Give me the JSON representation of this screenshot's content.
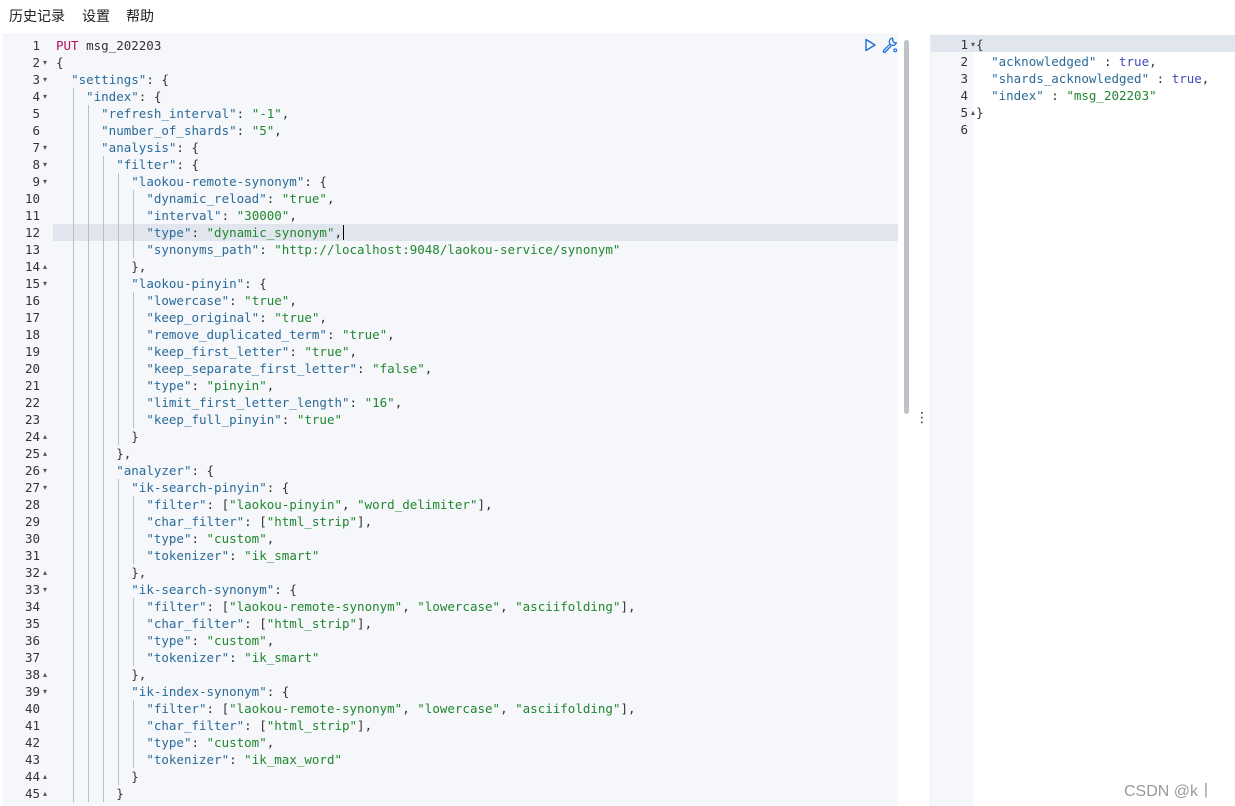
{
  "menu": [
    "历史记录",
    "设置",
    "帮助"
  ],
  "request": {
    "method": "PUT",
    "index": "msg_202203"
  },
  "editor_lines": [
    {
      "n": "1",
      "fold": "",
      "tokens": [
        [
          "m",
          "PUT"
        ],
        [
          "p",
          " msg_202203"
        ]
      ]
    },
    {
      "n": "2",
      "fold": "▾",
      "tokens": [
        [
          "p",
          "{"
        ]
      ]
    },
    {
      "n": "3",
      "fold": "▾",
      "tokens": [
        [
          "p",
          "  "
        ],
        [
          "k",
          "\"settings\""
        ],
        [
          "p",
          ": {"
        ]
      ]
    },
    {
      "n": "4",
      "fold": "▾",
      "tokens": [
        [
          "p",
          "    "
        ],
        [
          "k",
          "\"index\""
        ],
        [
          "p",
          ": {"
        ]
      ]
    },
    {
      "n": "5",
      "fold": "",
      "tokens": [
        [
          "p",
          "      "
        ],
        [
          "k",
          "\"refresh_interval\""
        ],
        [
          "p",
          ": "
        ],
        [
          "s",
          "\"-1\""
        ],
        [
          "p",
          ","
        ]
      ]
    },
    {
      "n": "6",
      "fold": "",
      "tokens": [
        [
          "p",
          "      "
        ],
        [
          "k",
          "\"number_of_shards\""
        ],
        [
          "p",
          ": "
        ],
        [
          "s",
          "\"5\""
        ],
        [
          "p",
          ","
        ]
      ]
    },
    {
      "n": "7",
      "fold": "▾",
      "tokens": [
        [
          "p",
          "      "
        ],
        [
          "k",
          "\"analysis\""
        ],
        [
          "p",
          ": {"
        ]
      ]
    },
    {
      "n": "8",
      "fold": "▾",
      "tokens": [
        [
          "p",
          "        "
        ],
        [
          "k",
          "\"filter\""
        ],
        [
          "p",
          ": {"
        ]
      ]
    },
    {
      "n": "9",
      "fold": "▾",
      "tokens": [
        [
          "p",
          "          "
        ],
        [
          "k",
          "\"laokou-remote-synonym\""
        ],
        [
          "p",
          ": {"
        ]
      ]
    },
    {
      "n": "10",
      "fold": "",
      "tokens": [
        [
          "p",
          "            "
        ],
        [
          "k",
          "\"dynamic_reload\""
        ],
        [
          "p",
          ": "
        ],
        [
          "s",
          "\"true\""
        ],
        [
          "p",
          ","
        ]
      ]
    },
    {
      "n": "11",
      "fold": "",
      "tokens": [
        [
          "p",
          "            "
        ],
        [
          "k",
          "\"interval\""
        ],
        [
          "p",
          ": "
        ],
        [
          "s",
          "\"30000\""
        ],
        [
          "p",
          ","
        ]
      ]
    },
    {
      "n": "12",
      "fold": "",
      "tokens": [
        [
          "p",
          "            "
        ],
        [
          "k",
          "\"type\""
        ],
        [
          "p",
          ": "
        ],
        [
          "s",
          "\"dynamic_synonym\""
        ],
        [
          "p",
          ","
        ]
      ]
    },
    {
      "n": "13",
      "fold": "",
      "tokens": [
        [
          "p",
          "            "
        ],
        [
          "k",
          "\"synonyms_path\""
        ],
        [
          "p",
          ": "
        ],
        [
          "s",
          "\"http://localhost:9048/laokou-service/synonym\""
        ]
      ]
    },
    {
      "n": "14",
      "fold": "▴",
      "tokens": [
        [
          "p",
          "          },"
        ]
      ]
    },
    {
      "n": "15",
      "fold": "▾",
      "tokens": [
        [
          "p",
          "          "
        ],
        [
          "k",
          "\"laokou-pinyin\""
        ],
        [
          "p",
          ": {"
        ]
      ]
    },
    {
      "n": "16",
      "fold": "",
      "tokens": [
        [
          "p",
          "            "
        ],
        [
          "k",
          "\"lowercase\""
        ],
        [
          "p",
          ": "
        ],
        [
          "s",
          "\"true\""
        ],
        [
          "p",
          ","
        ]
      ]
    },
    {
      "n": "17",
      "fold": "",
      "tokens": [
        [
          "p",
          "            "
        ],
        [
          "k",
          "\"keep_original\""
        ],
        [
          "p",
          ": "
        ],
        [
          "s",
          "\"true\""
        ],
        [
          "p",
          ","
        ]
      ]
    },
    {
      "n": "18",
      "fold": "",
      "tokens": [
        [
          "p",
          "            "
        ],
        [
          "k",
          "\"remove_duplicated_term\""
        ],
        [
          "p",
          ": "
        ],
        [
          "s",
          "\"true\""
        ],
        [
          "p",
          ","
        ]
      ]
    },
    {
      "n": "19",
      "fold": "",
      "tokens": [
        [
          "p",
          "            "
        ],
        [
          "k",
          "\"keep_first_letter\""
        ],
        [
          "p",
          ": "
        ],
        [
          "s",
          "\"true\""
        ],
        [
          "p",
          ","
        ]
      ]
    },
    {
      "n": "20",
      "fold": "",
      "tokens": [
        [
          "p",
          "            "
        ],
        [
          "k",
          "\"keep_separate_first_letter\""
        ],
        [
          "p",
          ": "
        ],
        [
          "s",
          "\"false\""
        ],
        [
          "p",
          ","
        ]
      ]
    },
    {
      "n": "21",
      "fold": "",
      "tokens": [
        [
          "p",
          "            "
        ],
        [
          "k",
          "\"type\""
        ],
        [
          "p",
          ": "
        ],
        [
          "s",
          "\"pinyin\""
        ],
        [
          "p",
          ","
        ]
      ]
    },
    {
      "n": "22",
      "fold": "",
      "tokens": [
        [
          "p",
          "            "
        ],
        [
          "k",
          "\"limit_first_letter_length\""
        ],
        [
          "p",
          ": "
        ],
        [
          "s",
          "\"16\""
        ],
        [
          "p",
          ","
        ]
      ]
    },
    {
      "n": "23",
      "fold": "",
      "tokens": [
        [
          "p",
          "            "
        ],
        [
          "k",
          "\"keep_full_pinyin\""
        ],
        [
          "p",
          ": "
        ],
        [
          "s",
          "\"true\""
        ]
      ]
    },
    {
      "n": "24",
      "fold": "▴",
      "tokens": [
        [
          "p",
          "          }"
        ]
      ]
    },
    {
      "n": "25",
      "fold": "▴",
      "tokens": [
        [
          "p",
          "        },"
        ]
      ]
    },
    {
      "n": "26",
      "fold": "▾",
      "tokens": [
        [
          "p",
          "        "
        ],
        [
          "k",
          "\"analyzer\""
        ],
        [
          "p",
          ": {"
        ]
      ]
    },
    {
      "n": "27",
      "fold": "▾",
      "tokens": [
        [
          "p",
          "          "
        ],
        [
          "k",
          "\"ik-search-pinyin\""
        ],
        [
          "p",
          ": {"
        ]
      ]
    },
    {
      "n": "28",
      "fold": "",
      "tokens": [
        [
          "p",
          "            "
        ],
        [
          "k",
          "\"filter\""
        ],
        [
          "p",
          ": ["
        ],
        [
          "s",
          "\"laokou-pinyin\""
        ],
        [
          "p",
          ", "
        ],
        [
          "s",
          "\"word_delimiter\""
        ],
        [
          "p",
          "],"
        ]
      ]
    },
    {
      "n": "29",
      "fold": "",
      "tokens": [
        [
          "p",
          "            "
        ],
        [
          "k",
          "\"char_filter\""
        ],
        [
          "p",
          ": ["
        ],
        [
          "s",
          "\"html_strip\""
        ],
        [
          "p",
          "],"
        ]
      ]
    },
    {
      "n": "30",
      "fold": "",
      "tokens": [
        [
          "p",
          "            "
        ],
        [
          "k",
          "\"type\""
        ],
        [
          "p",
          ": "
        ],
        [
          "s",
          "\"custom\""
        ],
        [
          "p",
          ","
        ]
      ]
    },
    {
      "n": "31",
      "fold": "",
      "tokens": [
        [
          "p",
          "            "
        ],
        [
          "k",
          "\"tokenizer\""
        ],
        [
          "p",
          ": "
        ],
        [
          "s",
          "\"ik_smart\""
        ]
      ]
    },
    {
      "n": "32",
      "fold": "▴",
      "tokens": [
        [
          "p",
          "          },"
        ]
      ]
    },
    {
      "n": "33",
      "fold": "▾",
      "tokens": [
        [
          "p",
          "          "
        ],
        [
          "k",
          "\"ik-search-synonym\""
        ],
        [
          "p",
          ": {"
        ]
      ]
    },
    {
      "n": "34",
      "fold": "",
      "tokens": [
        [
          "p",
          "            "
        ],
        [
          "k",
          "\"filter\""
        ],
        [
          "p",
          ": ["
        ],
        [
          "s",
          "\"laokou-remote-synonym\""
        ],
        [
          "p",
          ", "
        ],
        [
          "s",
          "\"lowercase\""
        ],
        [
          "p",
          ", "
        ],
        [
          "s",
          "\"asciifolding\""
        ],
        [
          "p",
          "],"
        ]
      ]
    },
    {
      "n": "35",
      "fold": "",
      "tokens": [
        [
          "p",
          "            "
        ],
        [
          "k",
          "\"char_filter\""
        ],
        [
          "p",
          ": ["
        ],
        [
          "s",
          "\"html_strip\""
        ],
        [
          "p",
          "],"
        ]
      ]
    },
    {
      "n": "36",
      "fold": "",
      "tokens": [
        [
          "p",
          "            "
        ],
        [
          "k",
          "\"type\""
        ],
        [
          "p",
          ": "
        ],
        [
          "s",
          "\"custom\""
        ],
        [
          "p",
          ","
        ]
      ]
    },
    {
      "n": "37",
      "fold": "",
      "tokens": [
        [
          "p",
          "            "
        ],
        [
          "k",
          "\"tokenizer\""
        ],
        [
          "p",
          ": "
        ],
        [
          "s",
          "\"ik_smart\""
        ]
      ]
    },
    {
      "n": "38",
      "fold": "▴",
      "tokens": [
        [
          "p",
          "          },"
        ]
      ]
    },
    {
      "n": "39",
      "fold": "▾",
      "tokens": [
        [
          "p",
          "          "
        ],
        [
          "k",
          "\"ik-index-synonym\""
        ],
        [
          "p",
          ": {"
        ]
      ]
    },
    {
      "n": "40",
      "fold": "",
      "tokens": [
        [
          "p",
          "            "
        ],
        [
          "k",
          "\"filter\""
        ],
        [
          "p",
          ": ["
        ],
        [
          "s",
          "\"laokou-remote-synonym\""
        ],
        [
          "p",
          ", "
        ],
        [
          "s",
          "\"lowercase\""
        ],
        [
          "p",
          ", "
        ],
        [
          "s",
          "\"asciifolding\""
        ],
        [
          "p",
          "],"
        ]
      ]
    },
    {
      "n": "41",
      "fold": "",
      "tokens": [
        [
          "p",
          "            "
        ],
        [
          "k",
          "\"char_filter\""
        ],
        [
          "p",
          ": ["
        ],
        [
          "s",
          "\"html_strip\""
        ],
        [
          "p",
          "],"
        ]
      ]
    },
    {
      "n": "42",
      "fold": "",
      "tokens": [
        [
          "p",
          "            "
        ],
        [
          "k",
          "\"type\""
        ],
        [
          "p",
          ": "
        ],
        [
          "s",
          "\"custom\""
        ],
        [
          "p",
          ","
        ]
      ]
    },
    {
      "n": "43",
      "fold": "",
      "tokens": [
        [
          "p",
          "            "
        ],
        [
          "k",
          "\"tokenizer\""
        ],
        [
          "p",
          ": "
        ],
        [
          "s",
          "\"ik_max_word\""
        ]
      ]
    },
    {
      "n": "44",
      "fold": "▴",
      "tokens": [
        [
          "p",
          "          }"
        ]
      ]
    },
    {
      "n": "45",
      "fold": "▴",
      "tokens": [
        [
          "p",
          "        }"
        ]
      ]
    }
  ],
  "active_line": "12",
  "output_lines": [
    {
      "n": "1",
      "fold": "▾",
      "tokens": [
        [
          "p",
          "{"
        ]
      ]
    },
    {
      "n": "2",
      "fold": "",
      "tokens": [
        [
          "p",
          "  "
        ],
        [
          "k",
          "\"acknowledged\""
        ],
        [
          "p",
          " : "
        ],
        [
          "b",
          "true"
        ],
        [
          "p",
          ","
        ]
      ]
    },
    {
      "n": "3",
      "fold": "",
      "tokens": [
        [
          "p",
          "  "
        ],
        [
          "k",
          "\"shards_acknowledged\""
        ],
        [
          "p",
          " : "
        ],
        [
          "b",
          "true"
        ],
        [
          "p",
          ","
        ]
      ]
    },
    {
      "n": "4",
      "fold": "",
      "tokens": [
        [
          "p",
          "  "
        ],
        [
          "k",
          "\"index\""
        ],
        [
          "p",
          " : "
        ],
        [
          "s",
          "\"msg_202203\""
        ]
      ]
    },
    {
      "n": "5",
      "fold": "▴",
      "tokens": [
        [
          "p",
          "}"
        ]
      ]
    },
    {
      "n": "6",
      "fold": "",
      "tokens": []
    }
  ],
  "watermark": "CSDN @k⼁",
  "icons": {
    "run": "play-icon",
    "settings": "wrench-icon",
    "resize": "vertical-dots-icon"
  },
  "colors": {
    "key": "#2b6b99",
    "string": "#21872f",
    "method": "#b80c62",
    "boolean": "#3f4bb8",
    "active_line": "#e1e6ee",
    "gutter": "#f5f7fa"
  }
}
